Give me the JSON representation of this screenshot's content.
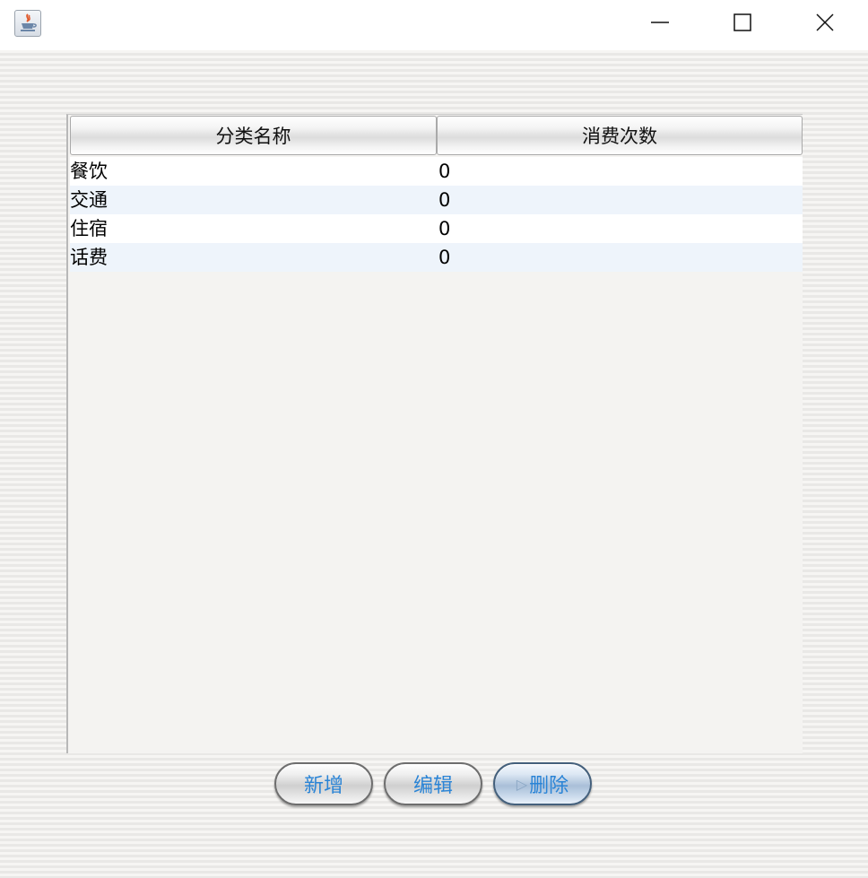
{
  "window": {
    "icon": "java-cup-icon",
    "controls": {
      "minimize_icon": "minimize-icon",
      "maximize_icon": "maximize-icon",
      "close_icon": "close-icon"
    }
  },
  "table": {
    "columns": [
      "分类名称",
      "消费次数"
    ],
    "rows": [
      [
        "餐饮",
        "0"
      ],
      [
        "交通",
        "0"
      ],
      [
        "住宿",
        "0"
      ],
      [
        "话费",
        "0"
      ]
    ]
  },
  "buttons": {
    "add_label": "新增",
    "edit_label": "编辑",
    "delete_label": "删除"
  },
  "colors": {
    "button_text": "#2a84d6",
    "row_alt": "#eef4fb"
  }
}
